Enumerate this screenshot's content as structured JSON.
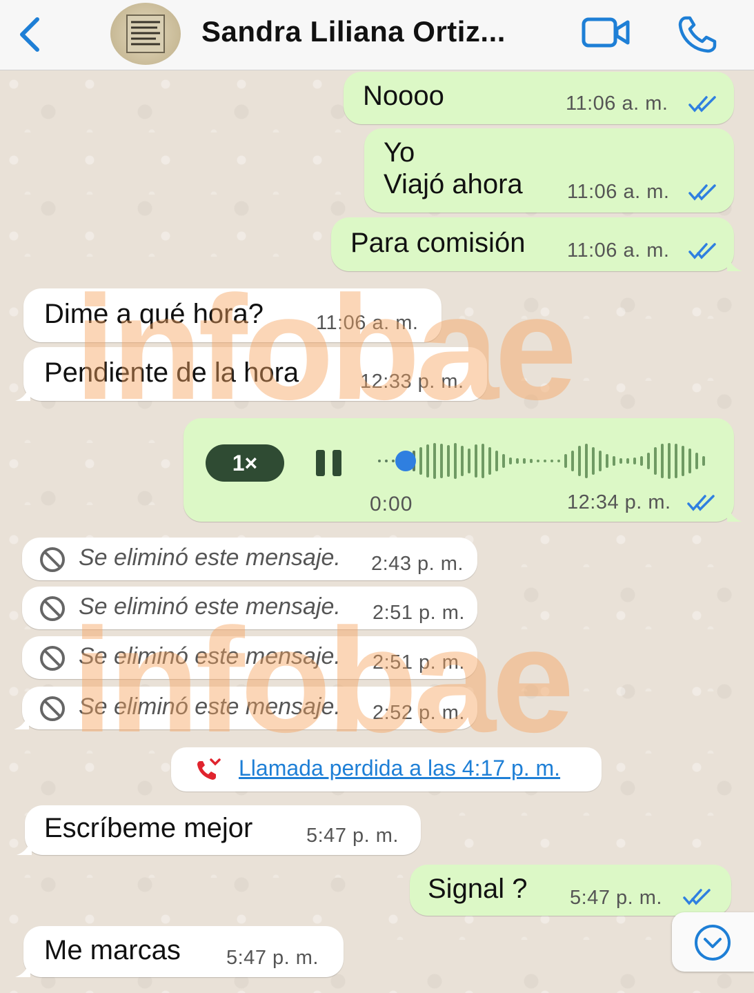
{
  "header": {
    "contact_name": "Sandra Liliana Ortiz..."
  },
  "watermark": "infobae",
  "messages": [
    {
      "direction": "out",
      "text": "Noooo",
      "time": "11:06 a. m.",
      "status": "read"
    },
    {
      "direction": "out",
      "line1": "Yo",
      "line2": "Viajó ahora",
      "time": "11:06 a. m.",
      "status": "read"
    },
    {
      "direction": "out",
      "text": "Para comisión",
      "time": "11:06 a. m.",
      "status": "read"
    },
    {
      "direction": "in",
      "text": "Dime a qué hora?",
      "time": "11:06 a. m."
    },
    {
      "direction": "in",
      "text": "Pendiente de la hora",
      "time": "12:33 p. m."
    },
    {
      "direction": "out",
      "type": "voice",
      "speed": "1×",
      "duration": "0:00",
      "time": "12:34 p. m.",
      "status": "read",
      "progress": 0
    },
    {
      "direction": "in",
      "type": "deleted",
      "text": "Se eliminó este mensaje.",
      "time": "2:43 p. m."
    },
    {
      "direction": "in",
      "type": "deleted",
      "text": "Se eliminó este mensaje.",
      "time": "2:51 p. m."
    },
    {
      "direction": "in",
      "type": "deleted",
      "text": "Se eliminó este mensaje.",
      "time": "2:51 p. m."
    },
    {
      "direction": "in",
      "type": "deleted",
      "text": "Se eliminó este mensaje.",
      "time": "2:52 p. m."
    },
    {
      "type": "missed_call",
      "text": "Llamada perdida a las 4:17 p. m."
    },
    {
      "direction": "in",
      "text": "Escríbeme mejor",
      "time": "5:47 p. m."
    },
    {
      "direction": "out",
      "text": "Signal ?",
      "time": "5:47 p. m.",
      "status": "read"
    },
    {
      "direction": "in",
      "text": "Me marcas",
      "time": "5:47 p. m."
    }
  ],
  "colors": {
    "outgoing_bubble": "#dcf8c6",
    "incoming_bubble": "#ffffff",
    "accent_blue": "#1e7fd6",
    "read_ticks": "#2f7fe0",
    "missed_call_red": "#e0242e",
    "watermark": "#f6a460"
  },
  "icons": {
    "back": "chevron-left-icon",
    "video": "video-camera-icon",
    "call": "phone-icon",
    "deleted": "ban-icon",
    "missed_call": "missed-call-icon",
    "scroll": "chevron-down-circle-icon"
  }
}
